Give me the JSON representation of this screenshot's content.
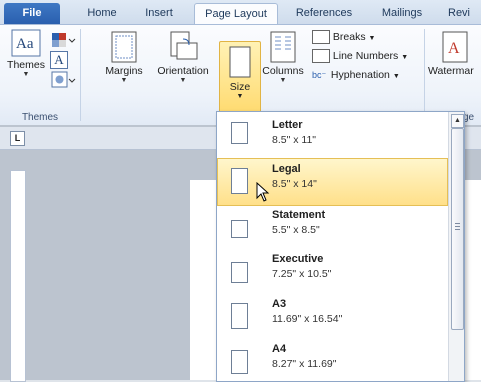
{
  "tabs": [
    {
      "label": "File"
    },
    {
      "label": "Home"
    },
    {
      "label": "Insert"
    },
    {
      "label": "Page Layout"
    },
    {
      "label": "References"
    },
    {
      "label": "Mailings"
    },
    {
      "label": "Revi"
    }
  ],
  "ribbon": {
    "themes_group": {
      "themes_label": "Themes",
      "colors_label": "",
      "fonts_label": "A",
      "group_label": "Themes"
    },
    "margins_label": "Margins",
    "orientation_label": "Orientation",
    "size_label": "Size",
    "columns_label": "Columns",
    "breaks_label": "Breaks",
    "line_numbers_label": "Line Numbers",
    "hyphenation_label": "Hyphenation",
    "watermark_label": "Watermar",
    "page_background_partial": "ge"
  },
  "ruler": {
    "tab_stop_symbol": "L"
  },
  "size_menu": {
    "items": [
      {
        "name": "Letter",
        "dimensions": "8.5\" x 11\""
      },
      {
        "name": "Legal",
        "dimensions": "8.5\" x 14\""
      },
      {
        "name": "Statement",
        "dimensions": "5.5\" x 8.5\""
      },
      {
        "name": "Executive",
        "dimensions": "7.25\" x 10.5\""
      },
      {
        "name": "A3",
        "dimensions": "11.69\" x 16.54\""
      },
      {
        "name": "A4",
        "dimensions": "8.27\" x 11.69\""
      }
    ],
    "hovered_item": "Legal"
  },
  "colors": {
    "accent": "#2a5fae",
    "highlight": "#ffd663",
    "ribbon_bg": "#eef3fa"
  }
}
